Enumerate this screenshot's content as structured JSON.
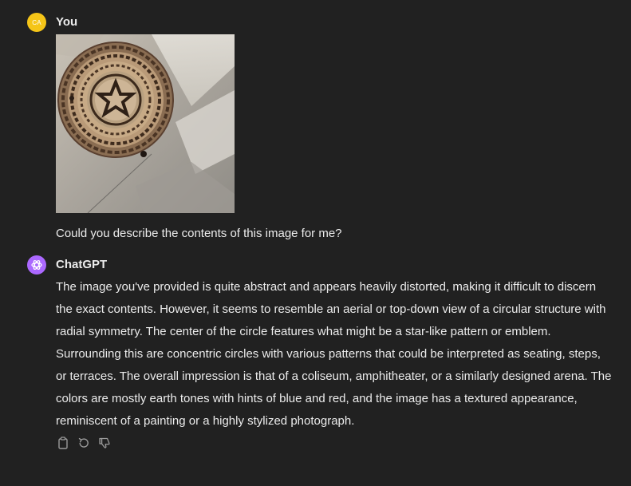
{
  "user_message": {
    "avatar_initials": "CA",
    "author": "You",
    "image_icon": "attached-image",
    "text": "Could you describe the contents of this image for me?"
  },
  "assistant_message": {
    "avatar_icon": "openai-logo-icon",
    "author": "ChatGPT",
    "text": "The image you've provided is quite abstract and appears heavily distorted, making it difficult to discern the exact contents. However, it seems to resemble an aerial or top-down view of a circular structure with radial symmetry. The center of the circle features what might be a star-like pattern or emblem. Surrounding this are concentric circles with various patterns that could be interpreted as seating, steps, or terraces. The overall impression is that of a coliseum, amphitheater, or a similarly designed arena. The colors are mostly earth tones with hints of blue and red, and the image has a textured appearance, reminiscent of a painting or a highly stylized photograph.",
    "actions": [
      "copy-icon",
      "regenerate-icon",
      "thumbs-down-icon"
    ]
  },
  "colors": {
    "background": "#212121",
    "text": "#ececec",
    "user_avatar": "#f5c518",
    "assistant_avatar": "#ab68ff",
    "action_icon": "#9b9b9b"
  }
}
